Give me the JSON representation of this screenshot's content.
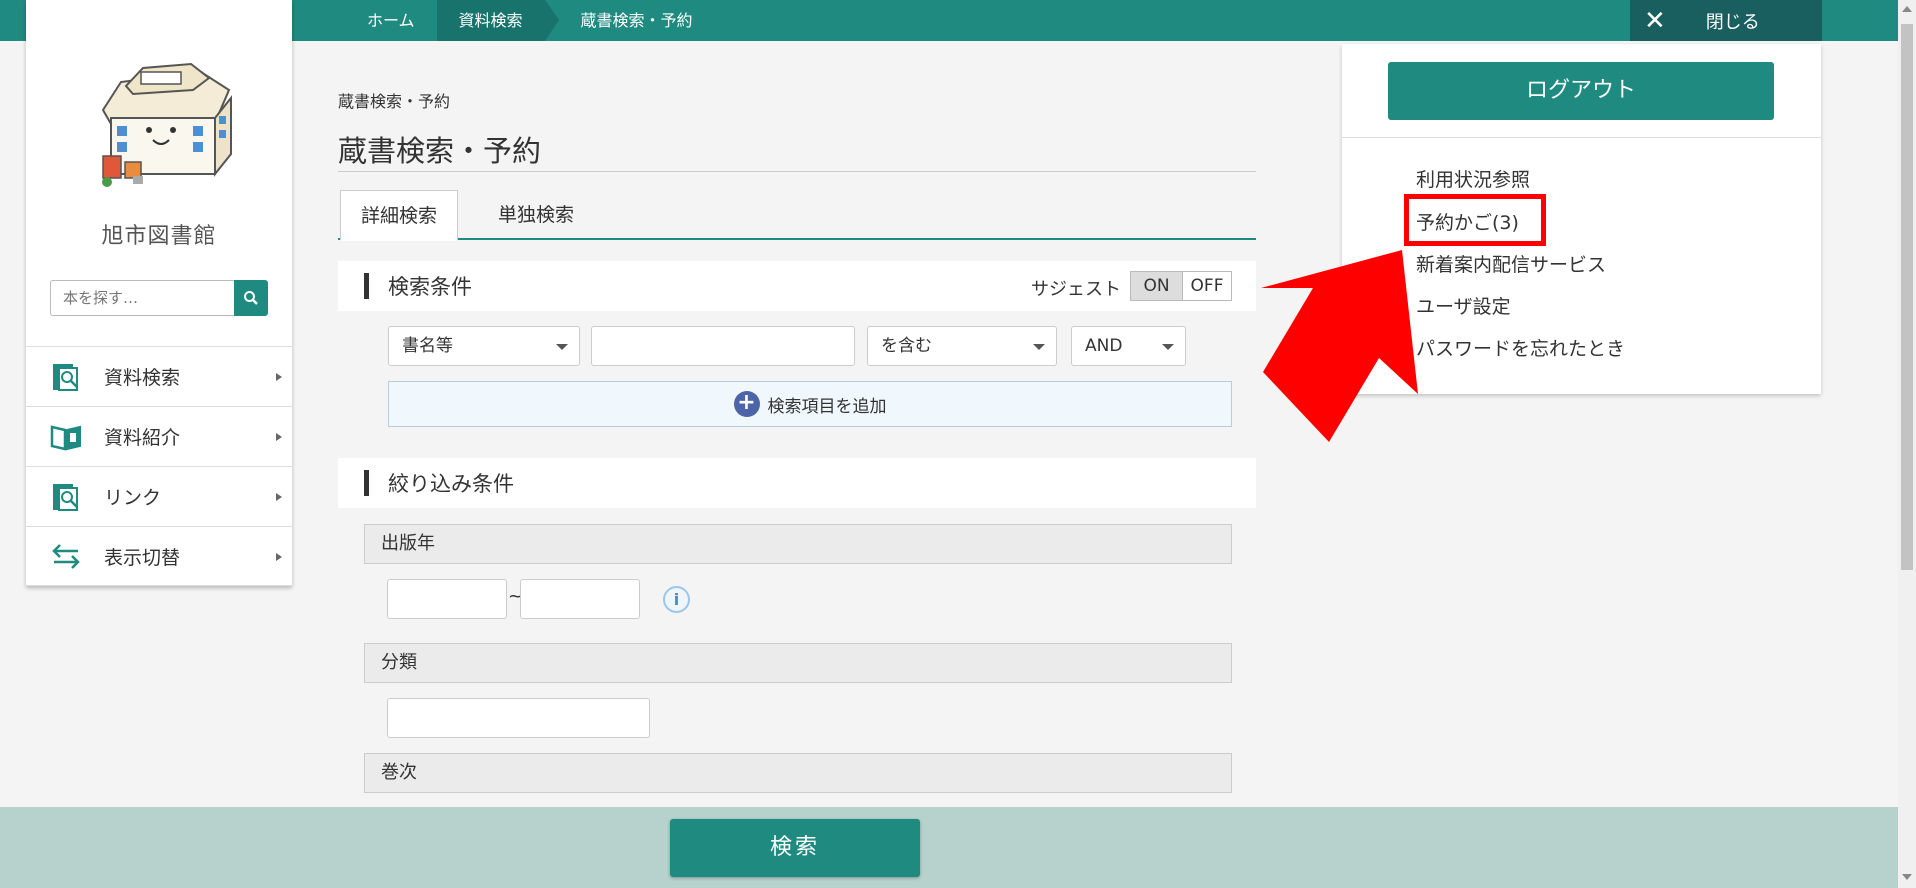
{
  "breadcrumb": {
    "home": "ホーム",
    "material_search": "資料検索",
    "current": "蔵書検索・予約"
  },
  "close": {
    "label": "閉じる"
  },
  "sidebar": {
    "library_name": "旭市図書館",
    "search_placeholder": "本を探す…",
    "items": [
      {
        "label": "資料検索",
        "icon": "magnifier-book-icon"
      },
      {
        "label": "資料紹介",
        "icon": "open-book-icon"
      },
      {
        "label": "リンク",
        "icon": "magnifier-book-icon"
      },
      {
        "label": "表示切替",
        "icon": "swap-arrows-icon"
      }
    ]
  },
  "main": {
    "page_crumb": "蔵書検索・予約",
    "title": "蔵書検索・予約",
    "tabs": [
      {
        "label": "詳細検索"
      },
      {
        "label": "単独検索"
      }
    ],
    "search_conditions": {
      "title": "検索条件",
      "suggest_label": "サジェスト",
      "toggle_on": "ON",
      "toggle_off": "OFF",
      "field_select": "書名等",
      "match_select": "を含む",
      "operator_select": "AND",
      "add_item": "検索項目を追加"
    },
    "filter_conditions": {
      "title": "絞り込み条件",
      "publish_year": "出版年",
      "range_separator": "~",
      "classification": "分類",
      "volume": "巻次"
    },
    "search_button": "検索"
  },
  "right_panel": {
    "logout": "ログアウト",
    "links": [
      "利用状況参照",
      "予約かご(3)",
      "新着案内配信サービス",
      "ユーザ設定",
      "パスワードを忘れたとき"
    ]
  },
  "colors": {
    "primary": "#1f8a80",
    "close_bg": "#1a5f5f",
    "highlight": "#ff0000",
    "bottom_bar": "#b7d2cd"
  }
}
